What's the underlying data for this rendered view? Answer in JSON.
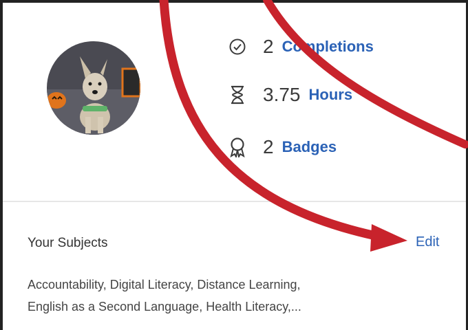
{
  "profile": {
    "avatar_icon": "dog-photo-avatar"
  },
  "stats": {
    "completions": {
      "count": "2",
      "label": "Completions",
      "icon": "check-circle-icon"
    },
    "hours": {
      "count": "3.75",
      "label": "Hours",
      "icon": "hourglass-icon"
    },
    "badges": {
      "count": "2",
      "label": "Badges",
      "icon": "badge-icon"
    }
  },
  "subjects": {
    "title": "Your Subjects",
    "edit_label": "Edit",
    "line1": "Accountability, Digital Literacy, Distance Learning,",
    "line2": "English as a Second Language, Health Literacy,..."
  },
  "colors": {
    "link": "#2b62b6",
    "annotation_arrow": "#c8232c"
  }
}
